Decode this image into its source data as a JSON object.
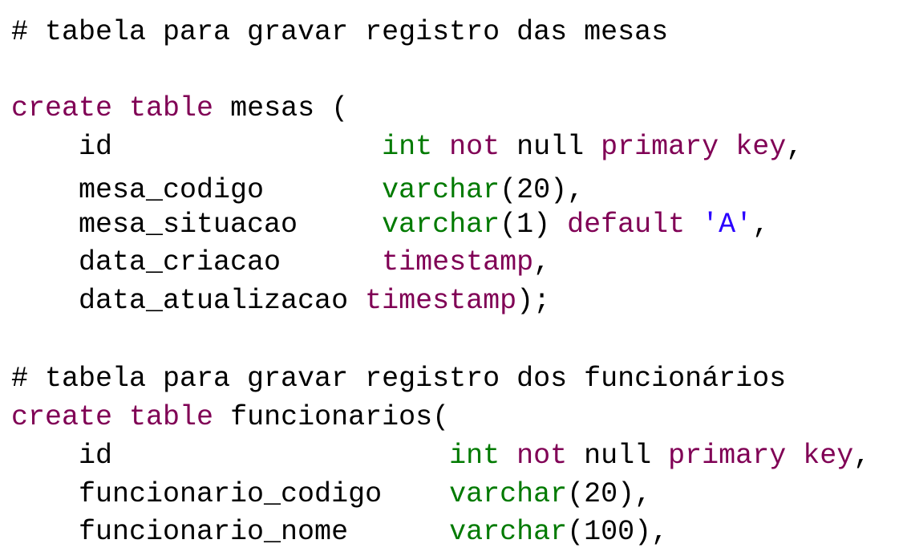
{
  "colors": {
    "background": "#ffffff",
    "plain": "#000000",
    "keyword": "#800055",
    "type": "#007a00",
    "string": "#2a00ff"
  },
  "lines": [
    {
      "tokens": [
        {
          "t": "# tabela para gravar registro das mesas",
          "k": "cm"
        }
      ]
    },
    {
      "tokens": [
        {
          "t": "create",
          "k": "kw"
        },
        {
          "t": " ",
          "k": "plain"
        },
        {
          "t": "table",
          "k": "kw"
        },
        {
          "t": " mesas (",
          "k": "plain"
        }
      ]
    },
    {
      "tokens": [
        {
          "t": "    id                ",
          "k": "plain"
        },
        {
          "t": "int",
          "k": "type"
        },
        {
          "t": " ",
          "k": "plain"
        },
        {
          "t": "not",
          "k": "kw"
        },
        {
          "t": " null ",
          "k": "plain"
        },
        {
          "t": "primary",
          "k": "kw"
        },
        {
          "t": " ",
          "k": "plain"
        },
        {
          "t": "key",
          "k": "kw"
        },
        {
          "t": ",",
          "k": "plain"
        }
      ]
    },
    {
      "tokens": [
        {
          "t": "    mesa_codigo       ",
          "k": "plain"
        },
        {
          "t": "varchar",
          "k": "type"
        },
        {
          "t": "(20),",
          "k": "plain"
        }
      ]
    },
    {
      "tokens": [
        {
          "t": "    mesa_situacao     ",
          "k": "plain"
        },
        {
          "t": "varchar",
          "k": "type"
        },
        {
          "t": "(1) ",
          "k": "plain"
        },
        {
          "t": "default",
          "k": "kw"
        },
        {
          "t": " ",
          "k": "plain"
        },
        {
          "t": "'A'",
          "k": "str"
        },
        {
          "t": ",",
          "k": "plain"
        }
      ]
    },
    {
      "tokens": [
        {
          "t": "    data_criacao      ",
          "k": "plain"
        },
        {
          "t": "timestamp",
          "k": "kw"
        },
        {
          "t": ",",
          "k": "plain"
        }
      ]
    },
    {
      "tokens": [
        {
          "t": "    data_atualizacao ",
          "k": "plain"
        },
        {
          "t": "timestamp",
          "k": "kw"
        },
        {
          "t": ");",
          "k": "plain"
        }
      ]
    },
    {
      "tokens": [
        {
          "t": "# tabela para gravar registro dos funcionários",
          "k": "cm"
        }
      ]
    },
    {
      "tokens": [
        {
          "t": "create",
          "k": "kw"
        },
        {
          "t": " ",
          "k": "plain"
        },
        {
          "t": "table",
          "k": "kw"
        },
        {
          "t": " funcionarios(",
          "k": "plain"
        }
      ]
    },
    {
      "tokens": [
        {
          "t": "    id                    ",
          "k": "plain"
        },
        {
          "t": "int",
          "k": "type"
        },
        {
          "t": " ",
          "k": "plain"
        },
        {
          "t": "not",
          "k": "kw"
        },
        {
          "t": " null ",
          "k": "plain"
        },
        {
          "t": "primary",
          "k": "kw"
        },
        {
          "t": " ",
          "k": "plain"
        },
        {
          "t": "key",
          "k": "kw"
        },
        {
          "t": ",",
          "k": "plain"
        }
      ]
    },
    {
      "tokens": [
        {
          "t": "    funcionario_codigo    ",
          "k": "plain"
        },
        {
          "t": "varchar",
          "k": "type"
        },
        {
          "t": "(20),",
          "k": "plain"
        }
      ]
    },
    {
      "tokens": [
        {
          "t": "    funcionario_nome      ",
          "k": "plain"
        },
        {
          "t": "varchar",
          "k": "type"
        },
        {
          "t": "(100),",
          "k": "plain"
        }
      ]
    }
  ]
}
